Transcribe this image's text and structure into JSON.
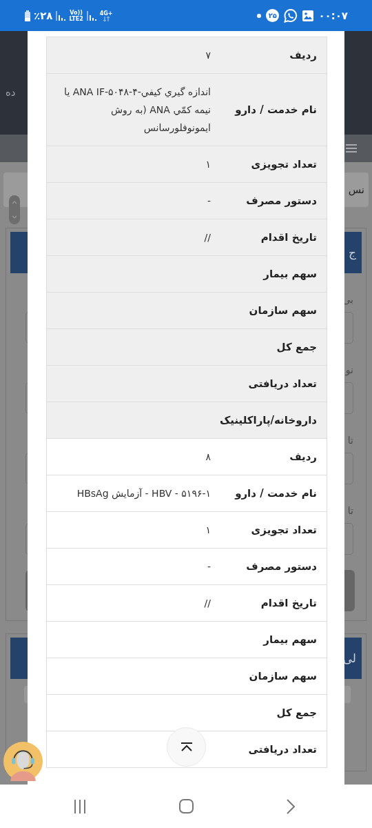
{
  "status_bar": {
    "battery": "٪۲۸",
    "volte": "Vo))",
    "carrier": "LTE2",
    "network": "4G+",
    "notification_count": "۲۵",
    "time": "۰۰:۰۷"
  },
  "background_page": {
    "header_text": "ده",
    "toolbar_text": "نس",
    "panels": [
      {
        "title": "ج",
        "fields": [
          {
            "label": "بی"
          },
          {
            "label": "نو"
          },
          {
            "label": "تا"
          },
          {
            "label": "تا"
          }
        ]
      },
      {
        "title": "لی"
      }
    ]
  },
  "dialog": {
    "records": [
      {
        "shaded": true,
        "rows": [
          {
            "label": "ردیف",
            "value": "۷"
          },
          {
            "label": "نام خدمت / دارو",
            "value": "اندازه گيري كيفي-ANA IF-۵۰۴۸-۴ يا نيمه كمّي ANA (به روش ايمونوفلورسانس"
          },
          {
            "label": "تعداد تجویزی",
            "value": "۱"
          },
          {
            "label": "دستور مصرف",
            "value": "-"
          },
          {
            "label": "تاریخ اقدام",
            "value": "//"
          },
          {
            "label": "سهم بیمار"
          },
          {
            "label": "سهم سازمان"
          },
          {
            "label": "جمع کل"
          },
          {
            "label": "تعداد دریافتی"
          },
          {
            "label": "داروخانه/پاراکلینیک"
          }
        ]
      },
      {
        "shaded": false,
        "rows": [
          {
            "label": "ردیف",
            "value": "۸"
          },
          {
            "label": "نام خدمت / دارو",
            "value": "۵۱۹۶-۱ - HBV - آزمایش HBsAg"
          },
          {
            "label": "تعداد تجویزی",
            "value": "۱"
          },
          {
            "label": "دستور مصرف",
            "value": "-"
          },
          {
            "label": "تاریخ اقدام",
            "value": "//"
          },
          {
            "label": "سهم بیمار"
          },
          {
            "label": "سهم سازمان"
          },
          {
            "label": "جمع کل"
          },
          {
            "label": "تعداد دریافتی"
          }
        ]
      }
    ]
  }
}
